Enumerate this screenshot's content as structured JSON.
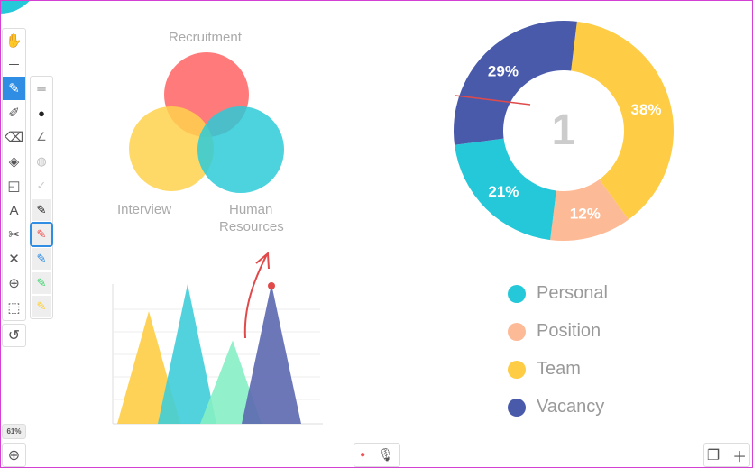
{
  "toolbar": {
    "tools": [
      "hand-icon",
      "plus-icon",
      "pen-icon",
      "highlighter-icon",
      "eraser-icon",
      "fill-icon",
      "shapes-icon",
      "text-icon",
      "scissors-icon",
      "close-icon",
      "target-icon",
      "select-icon"
    ],
    "selected": "pen-icon",
    "undo": "undo-icon"
  },
  "palette": {
    "items": [
      "line-width-icon",
      "dot-icon",
      "curve-icon",
      "hatch-icon",
      "check-icon"
    ],
    "pens": [
      "#222222",
      "#f05454",
      "#2f8de4",
      "#3fd46e",
      "#fcd03a"
    ],
    "selected_pen": "#f05454"
  },
  "zoom": {
    "level": "61%"
  },
  "venn": {
    "labels": {
      "top": "Recruitment",
      "left": "Interview",
      "right_1": "Human",
      "right_2": "Resources"
    },
    "colors": [
      "#ff6b6b",
      "#ffd24d",
      "#2dcbd8"
    ]
  },
  "donut": {
    "center_label": "1",
    "segments": [
      {
        "name": "Team",
        "value": 38,
        "label": "38%",
        "color": "#fecd45"
      },
      {
        "name": "Position",
        "value": 12,
        "label": "12%",
        "color": "#fdba96"
      },
      {
        "name": "Personal",
        "value": 21,
        "label": "21%",
        "color": "#25c8d8"
      },
      {
        "name": "Vacancy",
        "value": 29,
        "label": "29%",
        "color": "#4a5aab"
      }
    ]
  },
  "legend": [
    {
      "label": "Personal",
      "color": "#25c8d8"
    },
    {
      "label": "Position",
      "color": "#fdba96"
    },
    {
      "label": "Team",
      "color": "#fecd45"
    },
    {
      "label": "Vacancy",
      "color": "#4a5aab"
    }
  ],
  "chart_data": {
    "type": "area",
    "series": [
      {
        "values": [
          5
        ],
        "color": "#fecd45"
      },
      {
        "values": [
          6.2
        ],
        "color": "#3fcdd8"
      },
      {
        "values": [
          3.7
        ],
        "color": "#86f0c4"
      },
      {
        "values": [
          6.2
        ],
        "color": "#5c68b0"
      }
    ],
    "grid": true,
    "ylim": [
      0,
      6.2
    ]
  },
  "bottom": {
    "record": "record-icon",
    "mic": "microphone-icon",
    "pages": "pages-icon",
    "add": "add-page-icon",
    "zoom_in": "zoom-in-icon"
  }
}
